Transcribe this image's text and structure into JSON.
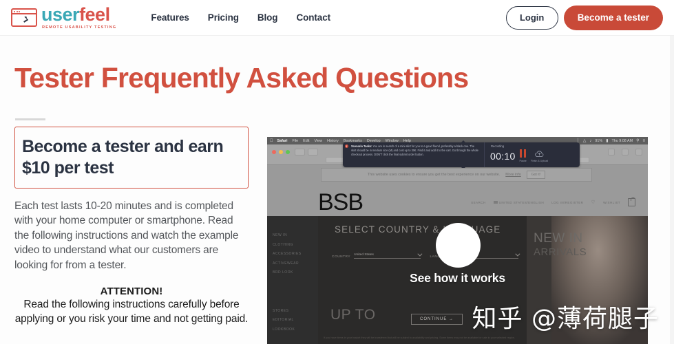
{
  "header": {
    "logo": {
      "icon": "browser-cursor-icon",
      "word_1": "user",
      "word_2": "feel",
      "tagline": "REMOTE USABILITY TESTING"
    },
    "nav": [
      {
        "label": "Features"
      },
      {
        "label": "Pricing"
      },
      {
        "label": "Blog"
      },
      {
        "label": "Contact"
      }
    ],
    "login_label": "Login",
    "cta_label": "Become a tester"
  },
  "page": {
    "title": "Tester Frequently Asked Questions"
  },
  "left": {
    "callout_heading": "Become a tester and earn $10 per test",
    "body": "Each test lasts 10-20 minutes and is completed with your home computer or smartphone. Read the following instructions and watch the example video to understand what our customers are looking for from a tester.",
    "attention_title": "ATTENTION!",
    "attention_body": "Read the following instructions carefully before applying or you risk your time and not getting paid."
  },
  "video": {
    "caption": "See how it works",
    "play_icon": "play-button-icon",
    "mac": {
      "apple_glyph": "",
      "menus": [
        "Safari",
        "File",
        "Edit",
        "View",
        "History",
        "Bookmarks",
        "Develop",
        "Window",
        "Help"
      ],
      "battery": "91%",
      "clock": "Thu 9:08 AM"
    },
    "recorder": {
      "task_label": "Scenario Tasks:",
      "task_text": "You are in search of a mini skirt for you to a good friend, preferably a black one. The skirt should be in medium size (M) and cost up to 30€. Find it and add it to the cart. Go through the whole checkout process. DON'T click the final submit order button.",
      "status_label": "Recording",
      "timer": "00:10",
      "pause_label": "Pause",
      "finish_label": "Finish & Upload"
    },
    "cookie": {
      "text": "This website uses cookies to ensure you get the best experience on our website.",
      "link": "More info",
      "button": "Got it!"
    },
    "site": {
      "logo": "BSB",
      "nav": [
        "SEARCH",
        "UNITED STATES/ENGLISH",
        "LOG IN/REGISTER",
        "WISHLIST"
      ],
      "side_menu_top": [
        "NEW IN",
        "CLOTHING",
        "ACCESSORIES",
        "ACTIVEWEAR",
        "BRD LOOK"
      ],
      "side_menu_bottom": [
        "STORES",
        "EDITORIAL",
        "LOOKBOOK"
      ],
      "modal_title": "SELECT COUNTRY & LANGUAGE",
      "country_label": "COUNTRY",
      "country_value": "United States",
      "language_label": "LANGUAGE",
      "language_value": "English",
      "continue_label": "CONTINUE  →",
      "promo_text": "UP TO",
      "right_heading": "NEW IN",
      "right_subheading": "ARRIVALS",
      "disclaimer": "If you have items in your basket they will be transferred but will be subject to availability and pricing. Some items may not be available for sale in your selected region."
    }
  },
  "watermark": "知乎 @薄荷腿子"
}
